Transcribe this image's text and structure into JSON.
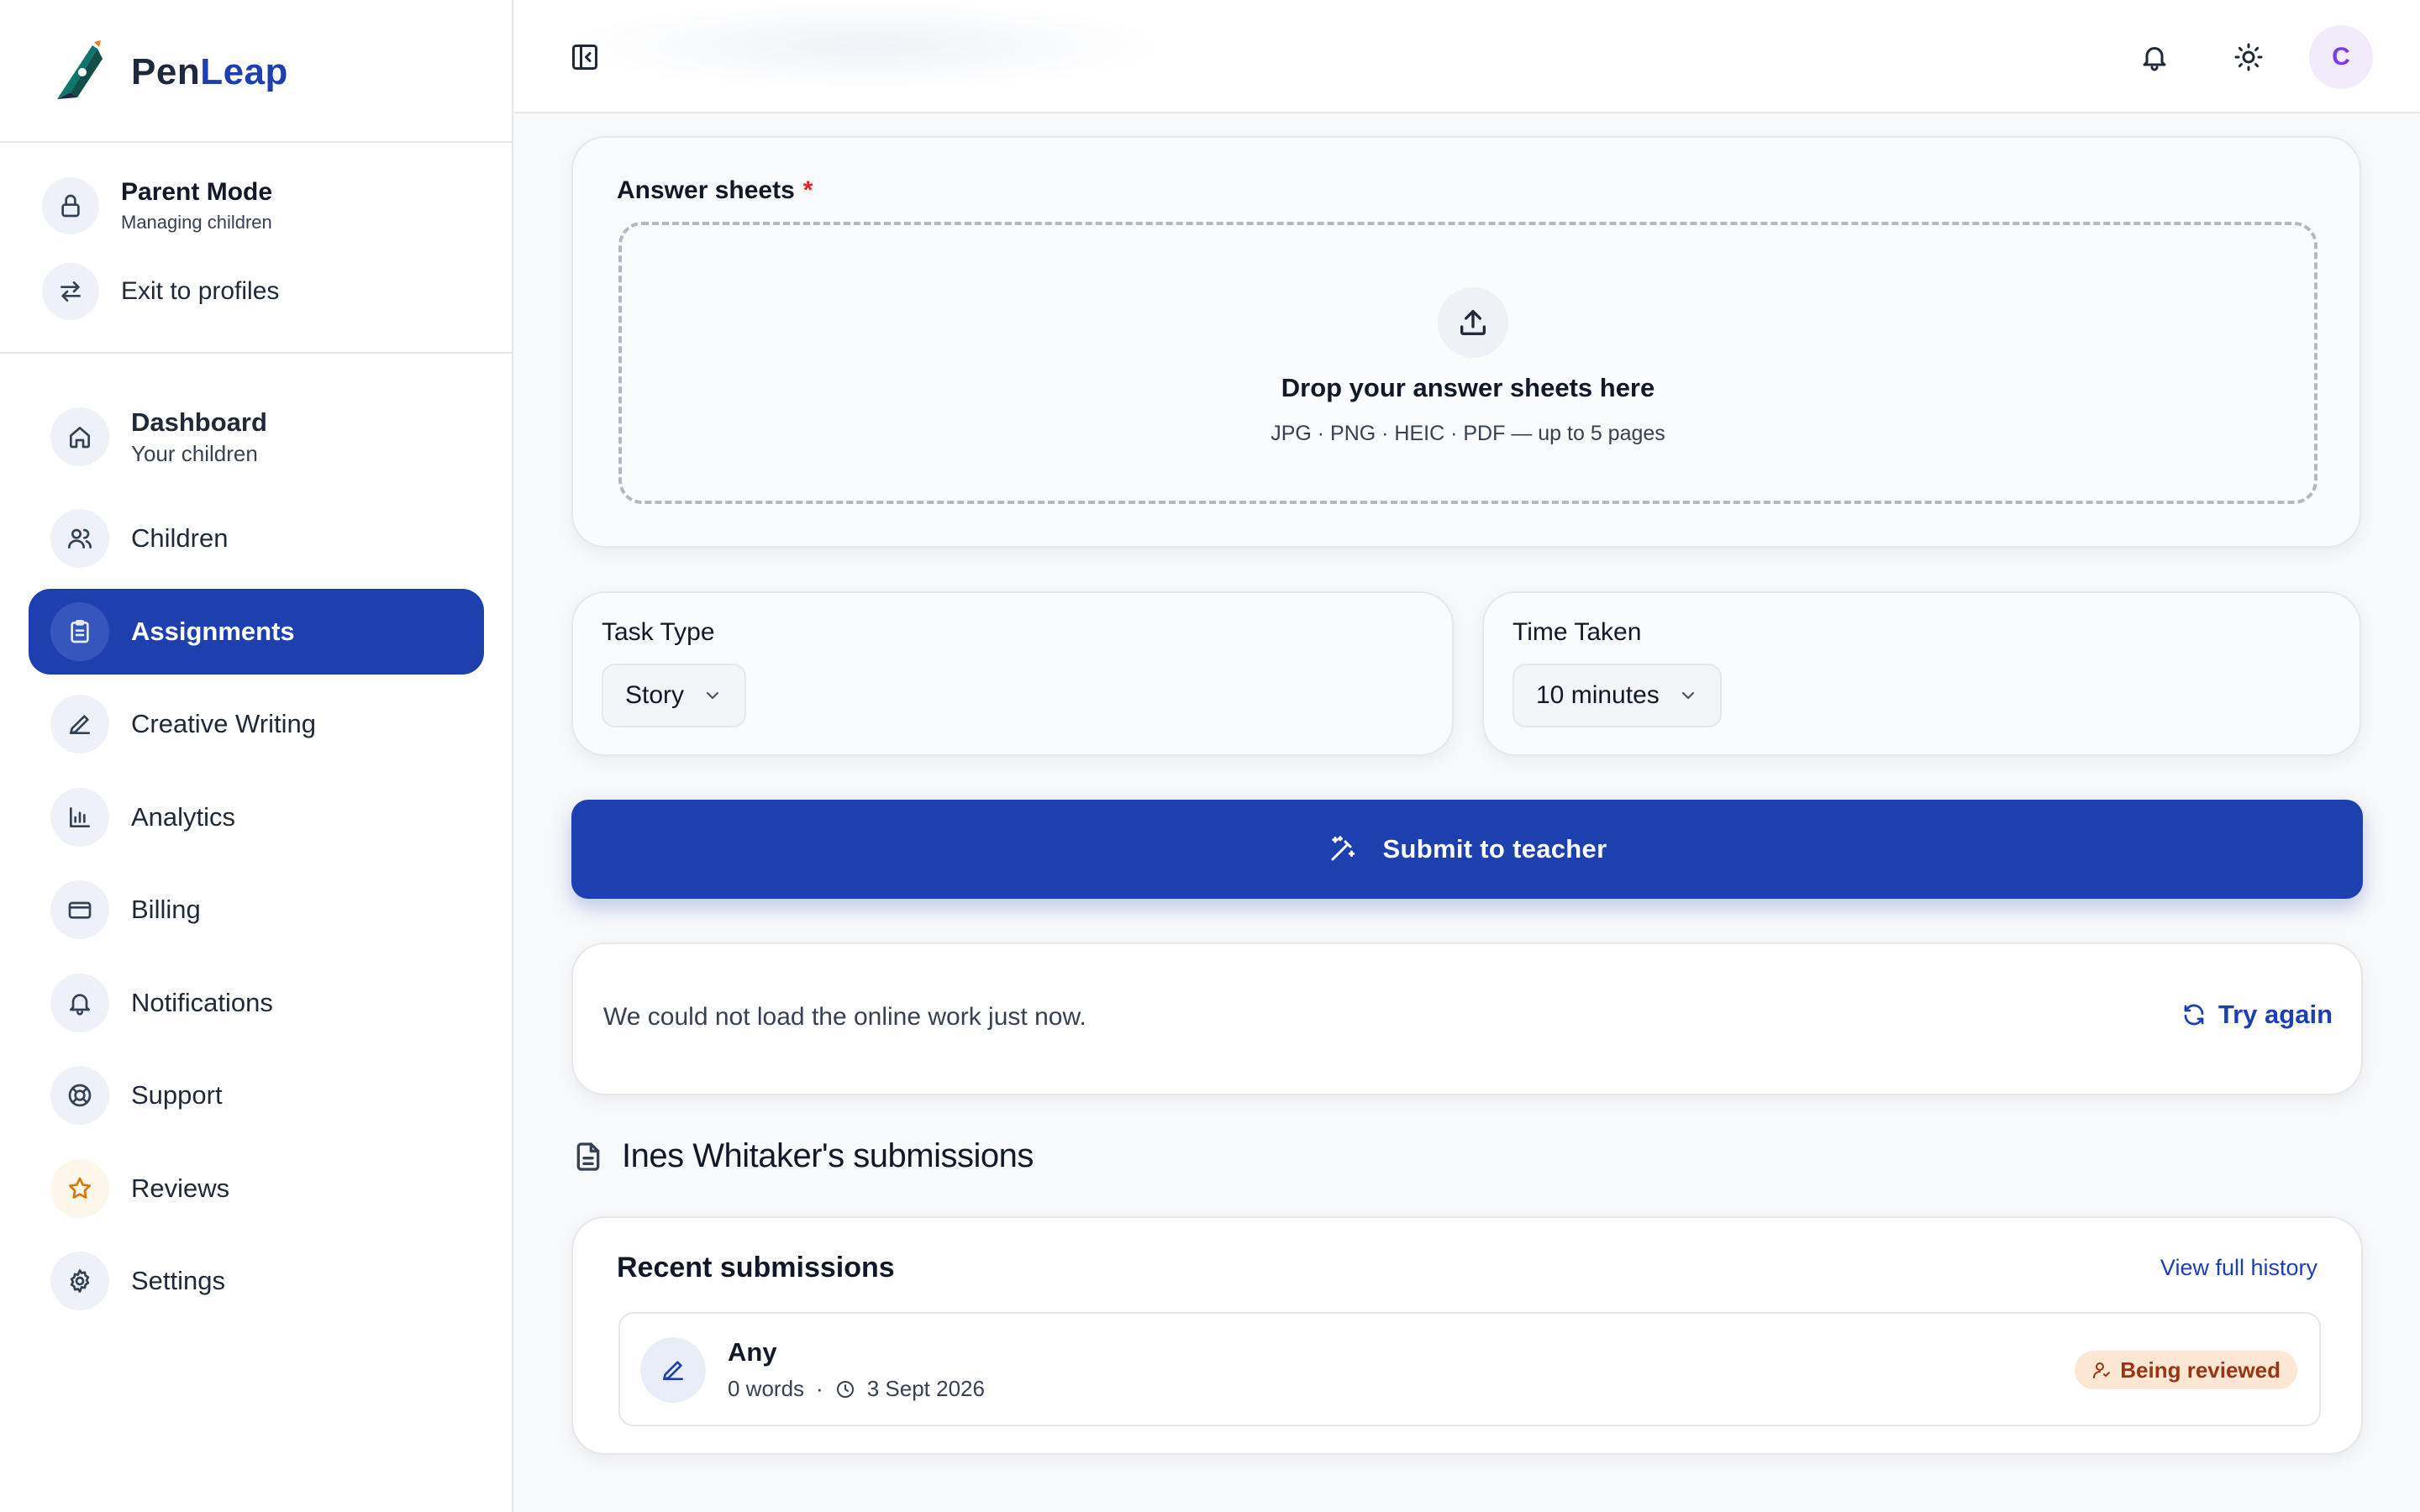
{
  "brand": {
    "prefix": "Pen",
    "suffix": "Leap"
  },
  "mode": {
    "title": "Parent Mode",
    "subtitle": "Managing children",
    "exit_label": "Exit to profiles"
  },
  "nav": {
    "dashboard": {
      "label": "Dashboard",
      "subtitle": "Your children"
    },
    "items": [
      {
        "label": "Children",
        "icon": "users-icon"
      },
      {
        "label": "Assignments",
        "icon": "clipboard-icon",
        "active": true
      },
      {
        "label": "Creative Writing",
        "icon": "pen-icon"
      },
      {
        "label": "Analytics",
        "icon": "bar-chart-icon"
      },
      {
        "label": "Billing",
        "icon": "credit-card-icon"
      },
      {
        "label": "Notifications",
        "icon": "bell-icon"
      },
      {
        "label": "Support",
        "icon": "lifebuoy-icon"
      },
      {
        "label": "Reviews",
        "icon": "star-icon"
      },
      {
        "label": "Settings",
        "icon": "gear-icon"
      }
    ]
  },
  "topbar": {
    "avatar_initial": "C"
  },
  "upload": {
    "label": "Answer sheets",
    "required_mark": "*",
    "title": "Drop your answer sheets here",
    "hint": "JPG · PNG · HEIC · PDF — up to 5 pages"
  },
  "task_type": {
    "label": "Task Type",
    "value": "Story"
  },
  "time_taken": {
    "label": "Time Taken",
    "value": "10 minutes"
  },
  "submit": {
    "label": "Submit to teacher"
  },
  "error": {
    "message": "We could not load the online work just now.",
    "retry_label": "Try again"
  },
  "submissions": {
    "heading": "Ines Whitaker's submissions",
    "card_title": "Recent submissions",
    "view_history": "View full history",
    "items": [
      {
        "title": "Any",
        "words": "0 words",
        "separator": "·",
        "date": "3 Sept 2026",
        "status": "Being reviewed"
      }
    ]
  },
  "colors": {
    "primary": "#1e40af",
    "accent_purple": "#7c3aed",
    "error_red": "#dc2626",
    "badge_bg": "#fbe7d3",
    "badge_text": "#9a3412"
  }
}
